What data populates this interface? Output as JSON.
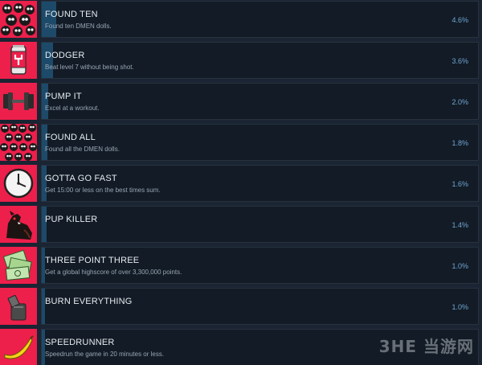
{
  "achievements": [
    {
      "icon": "dmen-dolls-group-icon",
      "title": "FOUND TEN",
      "description": "Found ten DMEN dolls.",
      "percent_label": "4.6%",
      "percent": 4.6
    },
    {
      "icon": "soda-can-icon",
      "title": "DODGER",
      "description": "Beat level 7 without being shot.",
      "percent_label": "3.6%",
      "percent": 3.6
    },
    {
      "icon": "dumbbell-icon",
      "title": "PUMP IT",
      "description": "Excel at a workout.",
      "percent_label": "2.0%",
      "percent": 2.0
    },
    {
      "icon": "dmen-dolls-crowd-icon",
      "title": "FOUND ALL",
      "description": "Found all the DMEN dolls.",
      "percent_label": "1.8%",
      "percent": 1.8
    },
    {
      "icon": "clock-icon",
      "title": "GOTTA GO FAST",
      "description": "Get 15:00 or less on the best times sum.",
      "percent_label": "1.6%",
      "percent": 1.6
    },
    {
      "icon": "dog-icon",
      "title": "PUP KILLER",
      "description": "",
      "percent_label": "1.4%",
      "percent": 1.4
    },
    {
      "icon": "cash-money-icon",
      "title": "THREE POINT THREE",
      "description": "Get a global highscore of over 3,300,000 points.",
      "percent_label": "1.0%",
      "percent": 1.0
    },
    {
      "icon": "zippo-lighter-icon",
      "title": "BURN EVERYTHING",
      "description": "",
      "percent_label": "1.0%",
      "percent": 1.0
    },
    {
      "icon": "banana-icon",
      "title": "SPEEDRUNNER",
      "description": "Speedrun the game in 20 minutes or less.",
      "percent_label": "",
      "percent": 1.0
    }
  ],
  "watermark": "3HE 当游网",
  "colors": {
    "background": "#1a2433",
    "row_panel": "#121b26",
    "progress_fill": "#1e4a6a",
    "icon_background": "#ed1f4b",
    "title_text": "#e6ebef",
    "description_text": "#98a6b3",
    "percent_text": "#70a6d2"
  }
}
